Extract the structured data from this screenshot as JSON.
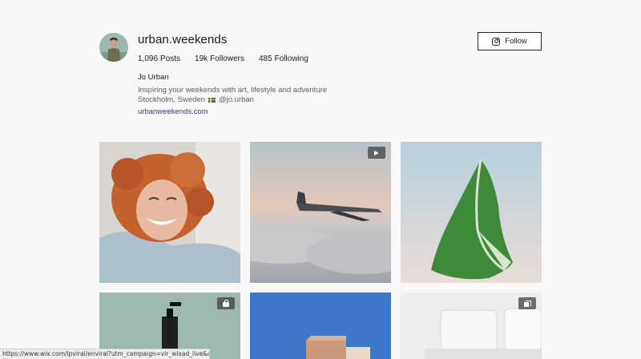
{
  "profile": {
    "username": "urban.weekends",
    "stats": {
      "posts_num": "1,096",
      "posts_label": "Posts",
      "followers_num": "19k",
      "followers_label": "Followers",
      "following_num": "485",
      "following_label": "Following"
    },
    "display_name": "Jo Urban",
    "bio": "Inspiring your weekends with art, lifestyle and adventure",
    "location": "Stockholm, Sweden",
    "location_flag": "swedish-flag-icon",
    "handle": "@jo.urban",
    "website": "urbanweekends.com"
  },
  "follow_button": {
    "label": "Follow",
    "icon": "instagram-icon"
  },
  "grid": {
    "tiles": [
      {
        "name": "laughing-woman-photo",
        "badge": ""
      },
      {
        "name": "airplane-above-clouds-photo",
        "badge": "play-icon"
      },
      {
        "name": "green-leaf-photo",
        "badge": ""
      },
      {
        "name": "soap-bottle-photo",
        "badge": "shopping-bag-icon"
      },
      {
        "name": "building-blue-sky-photo",
        "badge": ""
      },
      {
        "name": "white-sofa-photo",
        "badge": "multiple-images-icon"
      }
    ]
  },
  "status_bar": {
    "url": "https://www.wix.com/lpviral/enviral?utm_campaign=vir_wixad_live&adsVersi..."
  },
  "colors": {
    "background": "#f8f8f9",
    "link": "#2c3f8f",
    "muted_text": "#5d5d63"
  }
}
